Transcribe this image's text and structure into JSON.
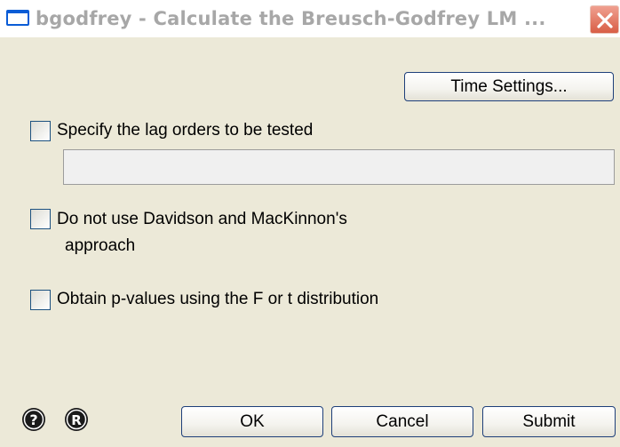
{
  "window": {
    "title": "bgodfrey - Calculate the Breusch-Godfrey LM ...",
    "title_color": "#A7A7A7",
    "close_icon": "close-icon"
  },
  "buttons": {
    "time_settings": "Time Settings...",
    "ok": "OK",
    "cancel": "Cancel",
    "submit": "Submit"
  },
  "options": {
    "lag_orders": {
      "label": "Specify the lag orders to be tested",
      "checked": false
    },
    "lag_orders_input": {
      "value": "",
      "placeholder": ""
    },
    "davidson": {
      "label_line1": "Do not use Davidson and MacKinnon's",
      "label_line2": "approach",
      "checked": false
    },
    "p_values": {
      "label": "Obtain p-values using the F or t distribution",
      "checked": false
    }
  },
  "footer": {
    "help_icon": "help-icon",
    "r_icon": "r-icon"
  },
  "colors": {
    "dialog_bg": "#ECE9D8",
    "button_border": "#1E3F7A",
    "checkbox_border": "#1C5180",
    "close_red": "#D85E45"
  }
}
